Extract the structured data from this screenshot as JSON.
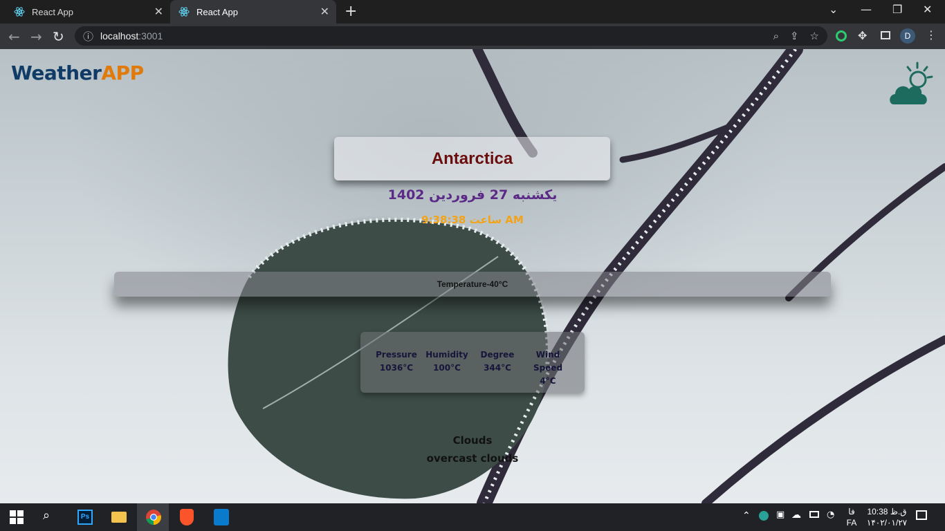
{
  "browser": {
    "tabs": [
      {
        "title": "React App",
        "active": false
      },
      {
        "title": "React App",
        "active": true
      }
    ],
    "url_host": "localhost",
    "url_port": ":3001",
    "profile_initial": "D"
  },
  "app": {
    "logo_part1": "Weather",
    "logo_part2": "APP",
    "city_value": "Antarctica",
    "date": "یکشنبه 27 فروردین 1402",
    "time": "ساعت 9:38:38 AM",
    "temperature": "Temperature-40°C",
    "stats": [
      {
        "label": "Pressure",
        "value": "1036°C"
      },
      {
        "label": "Humidity",
        "value": "100°C"
      },
      {
        "label": "Degree",
        "value": "344°C"
      },
      {
        "label": "Wind Speed",
        "value": "4°C"
      }
    ],
    "weather_main": "Clouds",
    "weather_desc": "overcast clouds"
  },
  "taskbar": {
    "lang": "فا",
    "lang_code": "FA",
    "time": "10:38 ق.ظ",
    "date": "۱۴۰۲/۰۱/۲۷"
  },
  "colors": {
    "accent_logo_blue": "#0f3b66",
    "accent_logo_orange": "#e07a0a",
    "city_text": "#6a0d0d",
    "date_text": "#5a2a86",
    "time_text": "#f2a317"
  }
}
